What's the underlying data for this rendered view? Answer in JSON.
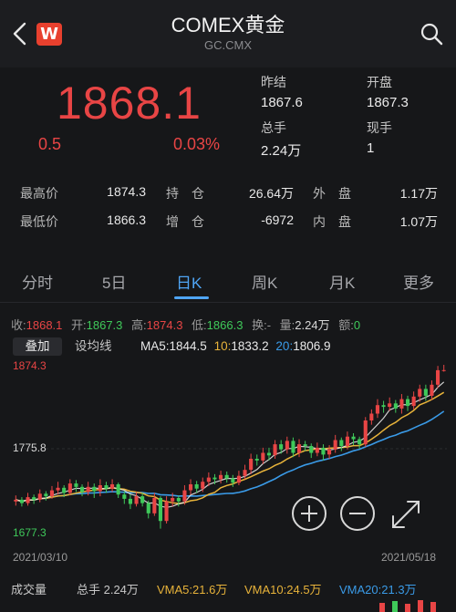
{
  "header": {
    "title": "COMEX黄金",
    "subtitle": "GC.CMX",
    "logo_letter": "W"
  },
  "quote": {
    "price": "1868.1",
    "change": "0.5",
    "change_pct": "0.03%",
    "prev_close_label": "昨结",
    "prev_close": "1867.6",
    "open_label": "开盘",
    "open": "1867.3",
    "total_volume_label": "总手",
    "total_volume": "2.24万",
    "current_volume_label": "现手",
    "current_volume": "1"
  },
  "stats": {
    "high_label": "最高价",
    "high": "1874.3",
    "low_label": "最低价",
    "low": "1866.3",
    "open_interest_label": "持　仓",
    "open_interest": "26.64万",
    "oi_change_label": "增　仓",
    "oi_change": "-6972",
    "outer_label": "外　盘",
    "outer": "1.17万",
    "inner_label": "内　盘",
    "inner": "1.07万"
  },
  "tabs": [
    "分时",
    "5日",
    "日K",
    "周K",
    "月K",
    "更多"
  ],
  "active_tab": "日K",
  "ohlc": {
    "close_label": "收:",
    "close": "1868.1",
    "open_label": "开:",
    "open": "1867.3",
    "high_label": "高:",
    "high": "1874.3",
    "low_label": "低:",
    "low": "1866.3",
    "turnover_label": "换:",
    "turnover": "-",
    "volume_label": "量:",
    "volume": "2.24万",
    "amount_label": "额:",
    "amount": "0"
  },
  "ma_bar": {
    "overlay_button": "叠加",
    "ma_button": "设均线",
    "ma5_label": "MA5:",
    "ma5": "1844.5",
    "ma10_label": "10:",
    "ma10": "1833.2",
    "ma20_label": "20:",
    "ma20": "1806.9"
  },
  "axis": {
    "max": "1874.3",
    "mid": "1775.8",
    "min": "1677.3",
    "date_start": "2021/03/10",
    "date_end": "2021/05/18"
  },
  "volume_bar": {
    "label": "成交量",
    "total": "总手 2.24万",
    "vma5": "VMA5:21.6万",
    "vma10": "VMA10:24.5万",
    "vma20": "VMA20:21.3万"
  },
  "colors": {
    "up": "#e84545",
    "down": "#3fc95a",
    "ma5": "#f2f2f2",
    "ma10": "#e8b33a",
    "ma20": "#3a9be8",
    "accent": "#4fa5f5"
  },
  "chart_data": {
    "type": "candlestick",
    "ylim": [
      1677.3,
      1874.3
    ],
    "x_range": [
      "2021/03/10",
      "2021/05/18"
    ],
    "candles": [
      [
        1714,
        1716,
        1709,
        1721
      ],
      [
        1716,
        1712,
        1708,
        1719
      ],
      [
        1712,
        1719,
        1709,
        1724
      ],
      [
        1719,
        1716,
        1711,
        1722
      ],
      [
        1716,
        1723,
        1713,
        1728
      ],
      [
        1723,
        1720,
        1715,
        1726
      ],
      [
        1720,
        1727,
        1717,
        1732
      ],
      [
        1727,
        1730,
        1722,
        1737
      ],
      [
        1730,
        1724,
        1719,
        1733
      ],
      [
        1724,
        1735,
        1721,
        1740
      ],
      [
        1735,
        1731,
        1725,
        1739
      ],
      [
        1731,
        1725,
        1720,
        1734
      ],
      [
        1725,
        1731,
        1721,
        1737
      ],
      [
        1731,
        1726,
        1718,
        1735
      ],
      [
        1726,
        1733,
        1720,
        1740
      ],
      [
        1733,
        1729,
        1724,
        1737
      ],
      [
        1729,
        1734,
        1725,
        1740
      ],
      [
        1734,
        1722,
        1718,
        1736
      ],
      [
        1722,
        1717,
        1711,
        1726
      ],
      [
        1717,
        1711,
        1705,
        1722
      ],
      [
        1711,
        1720,
        1708,
        1725
      ],
      [
        1720,
        1712,
        1708,
        1724
      ],
      [
        1712,
        1700,
        1694,
        1715
      ],
      [
        1700,
        1718,
        1697,
        1724
      ],
      [
        1718,
        1691,
        1682,
        1720
      ],
      [
        1691,
        1714,
        1688,
        1720
      ],
      [
        1714,
        1718,
        1708,
        1724
      ],
      [
        1718,
        1714,
        1708,
        1721
      ],
      [
        1714,
        1727,
        1710,
        1733
      ],
      [
        1727,
        1734,
        1722,
        1740
      ],
      [
        1734,
        1729,
        1724,
        1738
      ],
      [
        1729,
        1737,
        1725,
        1742
      ],
      [
        1737,
        1742,
        1732,
        1748
      ],
      [
        1742,
        1740,
        1734,
        1746
      ],
      [
        1740,
        1745,
        1735,
        1750
      ],
      [
        1745,
        1741,
        1736,
        1749
      ],
      [
        1741,
        1736,
        1731,
        1745
      ],
      [
        1736,
        1744,
        1733,
        1750
      ],
      [
        1744,
        1751,
        1740,
        1757
      ],
      [
        1751,
        1764,
        1746,
        1770
      ],
      [
        1764,
        1762,
        1756,
        1769
      ],
      [
        1762,
        1771,
        1758,
        1777
      ],
      [
        1771,
        1768,
        1762,
        1777
      ],
      [
        1768,
        1781,
        1764,
        1786
      ],
      [
        1781,
        1775,
        1770,
        1786
      ],
      [
        1775,
        1785,
        1770,
        1790
      ],
      [
        1785,
        1771,
        1766,
        1789
      ],
      [
        1771,
        1781,
        1766,
        1787
      ],
      [
        1781,
        1779,
        1773,
        1785
      ],
      [
        1779,
        1771,
        1765,
        1782
      ],
      [
        1771,
        1777,
        1767,
        1783
      ],
      [
        1777,
        1769,
        1762,
        1781
      ],
      [
        1769,
        1775,
        1764,
        1780
      ],
      [
        1775,
        1786,
        1771,
        1792
      ],
      [
        1786,
        1779,
        1773,
        1789
      ],
      [
        1779,
        1790,
        1775,
        1796
      ],
      [
        1790,
        1787,
        1780,
        1794
      ],
      [
        1787,
        1781,
        1776,
        1790
      ],
      [
        1781,
        1809,
        1778,
        1813
      ],
      [
        1809,
        1817,
        1804,
        1822
      ],
      [
        1817,
        1827,
        1812,
        1834
      ],
      [
        1827,
        1825,
        1818,
        1832
      ],
      [
        1825,
        1829,
        1820,
        1836
      ],
      [
        1829,
        1823,
        1818,
        1833
      ],
      [
        1823,
        1834,
        1817,
        1840
      ],
      [
        1834,
        1826,
        1820,
        1838
      ],
      [
        1826,
        1837,
        1822,
        1843
      ],
      [
        1837,
        1846,
        1831,
        1851
      ],
      [
        1846,
        1838,
        1832,
        1851
      ],
      [
        1838,
        1851,
        1833,
        1856
      ],
      [
        1851,
        1868,
        1847,
        1873
      ],
      [
        1868,
        1868.1,
        1866.3,
        1874.3
      ]
    ]
  }
}
